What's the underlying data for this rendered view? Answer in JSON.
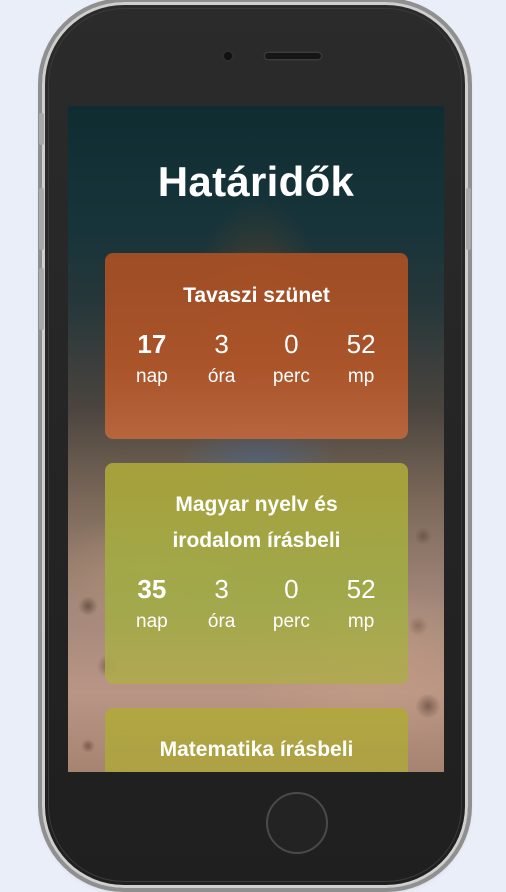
{
  "page": {
    "title": "Határidők"
  },
  "deadlines": [
    {
      "title": "Tavaszi szünet",
      "color": "#b5562a",
      "countdown": {
        "days": "17",
        "hours": "3",
        "minutes": "0",
        "seconds": "52"
      }
    },
    {
      "title": "Magyar nyelv és irodalom írásbeli",
      "color": "#a9a53c",
      "countdown": {
        "days": "35",
        "hours": "3",
        "minutes": "0",
        "seconds": "52"
      }
    },
    {
      "title": "Matematika írásbeli",
      "color": "#b1a83c"
    }
  ],
  "labels": {
    "days": "nap",
    "hours": "óra",
    "minutes": "perc",
    "seconds": "mp"
  },
  "icons": {
    "camera": "camera-icon",
    "speaker": "speaker-icon",
    "home": "home-button-icon"
  }
}
